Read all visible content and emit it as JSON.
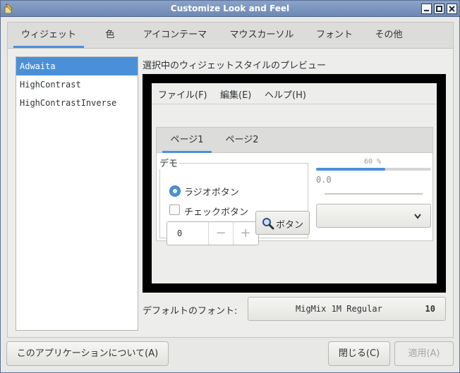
{
  "window": {
    "title": "Customize Look and Feel",
    "controls": [
      "minimize-icon",
      "maximize-icon",
      "close-icon"
    ]
  },
  "tabs": [
    {
      "label": "ウィジェット",
      "active": true
    },
    {
      "label": "色",
      "active": false
    },
    {
      "label": "アイコンテーマ",
      "active": false
    },
    {
      "label": "マウスカーソル",
      "active": false
    },
    {
      "label": "フォント",
      "active": false
    },
    {
      "label": "その他",
      "active": false
    }
  ],
  "themes": {
    "items": [
      "Adwaita",
      "HighContrast",
      "HighContrastInverse"
    ],
    "selected": "Adwaita"
  },
  "preview": {
    "label": "選択中のウィジェットスタイルのプレビュー",
    "menu": [
      "ファイル(F)",
      "編集(E)",
      "ヘルプ(H)"
    ],
    "tabs": [
      "ページ1",
      "ページ2"
    ],
    "demo": {
      "legend": "デモ",
      "radio_label": "ラジオボタン",
      "radio_checked": true,
      "check_label": "チェックボタン",
      "check_checked": false,
      "spin_value": "0",
      "spin_minus": "−",
      "spin_plus": "+",
      "button_label": "ボタン"
    },
    "progress": {
      "text": "60 %",
      "fraction": 0.6
    },
    "scale_value": "0.0"
  },
  "font": {
    "label": "デフォルトのフォント:",
    "name": "MigMix 1M Regular",
    "size": "10"
  },
  "buttons": {
    "about": "このアプリケーションについて(A)",
    "close": "閉じる(C)",
    "apply": "適用(A)"
  },
  "colors": {
    "accent": "#4a90d9",
    "titlebar": "#7890bd"
  }
}
